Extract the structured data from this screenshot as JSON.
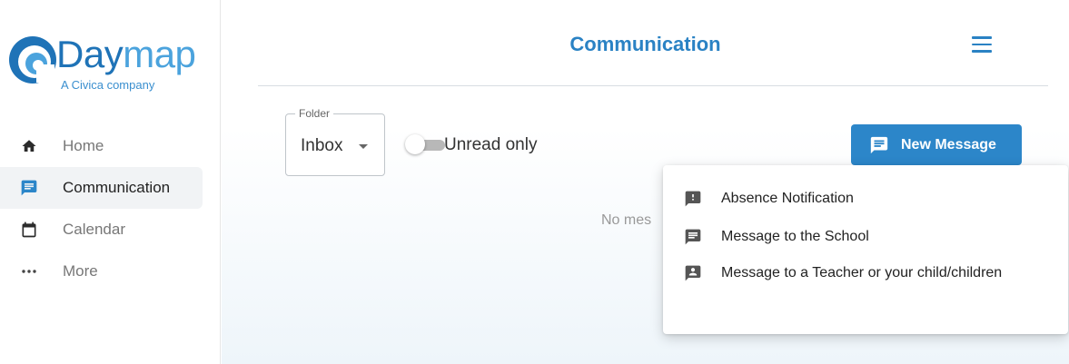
{
  "brand": {
    "name_part1": "Day",
    "name_part2": "map",
    "tagline": "A Civica company",
    "color": "#2e86c8"
  },
  "sidebar": {
    "items": [
      {
        "label": "Home",
        "icon": "home-icon",
        "active": false
      },
      {
        "label": "Communication",
        "icon": "message-icon",
        "active": true
      },
      {
        "label": "Calendar",
        "icon": "calendar-icon",
        "active": false
      },
      {
        "label": "More",
        "icon": "more-dots-icon",
        "active": false
      }
    ]
  },
  "header": {
    "title": "Communication",
    "menu_icon": "hamburger-icon",
    "accent_color": "#2a82c4"
  },
  "filters": {
    "folder_label": "Folder",
    "folder_value": "Inbox",
    "unread_only_label": "Unread only",
    "unread_only_enabled": false
  },
  "actions": {
    "new_message_label": "New Message",
    "button_color": "#2c86c9"
  },
  "content": {
    "empty_text": "No mes"
  },
  "new_message_menu": {
    "items": [
      {
        "label": "Absence Notification",
        "icon": "alert-message-icon"
      },
      {
        "label": "Message to the School",
        "icon": "message-icon"
      },
      {
        "label": "Message to a Teacher or your child/children",
        "icon": "person-message-icon"
      }
    ]
  }
}
